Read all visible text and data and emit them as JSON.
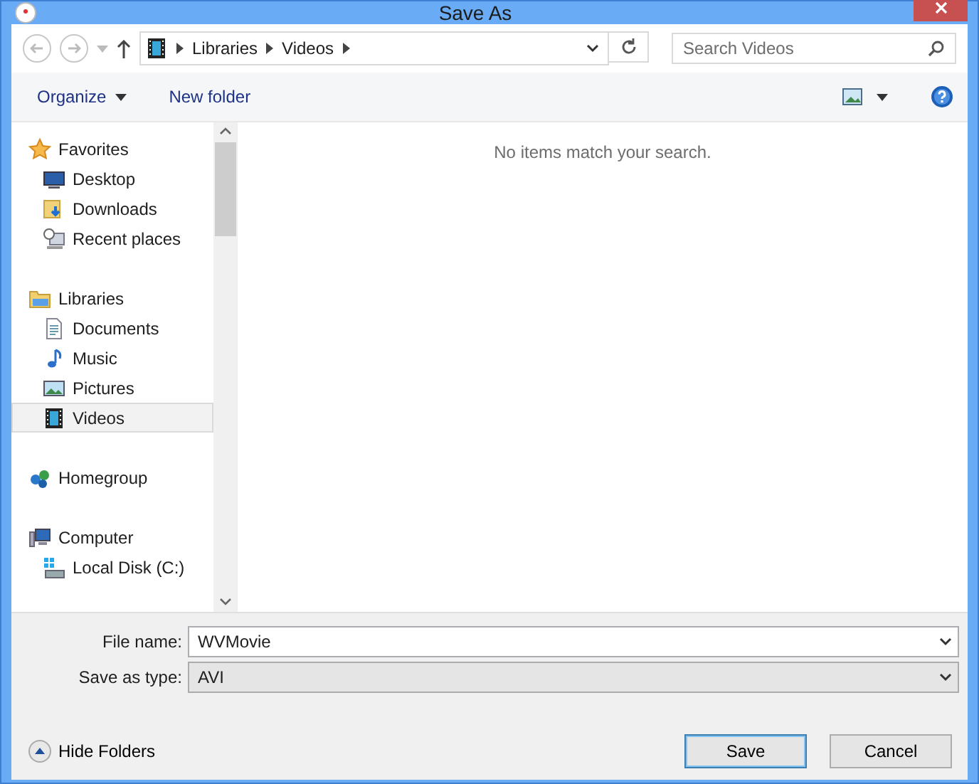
{
  "window": {
    "title": "Save As"
  },
  "address": {
    "segments": [
      "Libraries",
      "Videos"
    ]
  },
  "search": {
    "placeholder": "Search Videos"
  },
  "toolbar": {
    "organize": "Organize",
    "new_folder": "New folder"
  },
  "sidebar": {
    "groups": [
      {
        "label": "Favorites",
        "selected": false,
        "children": [
          {
            "label": "Desktop",
            "selected": false
          },
          {
            "label": "Downloads",
            "selected": false
          },
          {
            "label": "Recent places",
            "selected": false
          }
        ]
      },
      {
        "label": "Libraries",
        "selected": false,
        "children": [
          {
            "label": "Documents",
            "selected": false
          },
          {
            "label": "Music",
            "selected": false
          },
          {
            "label": "Pictures",
            "selected": false
          },
          {
            "label": "Videos",
            "selected": true
          }
        ]
      },
      {
        "label": "Homegroup",
        "selected": false
      },
      {
        "label": "Computer",
        "selected": false,
        "children": [
          {
            "label": "Local Disk (C:)",
            "selected": false
          }
        ]
      }
    ]
  },
  "content": {
    "empty_message": "No items match your search."
  },
  "form": {
    "file_name_label": "File name:",
    "file_name": "WVMovie",
    "type_label": "Save as type:",
    "type": "AVI"
  },
  "footer": {
    "hide_folders": "Hide Folders",
    "buttons": [
      {
        "label": "Save",
        "selected": true
      },
      {
        "label": "Cancel",
        "selected": false
      }
    ]
  }
}
